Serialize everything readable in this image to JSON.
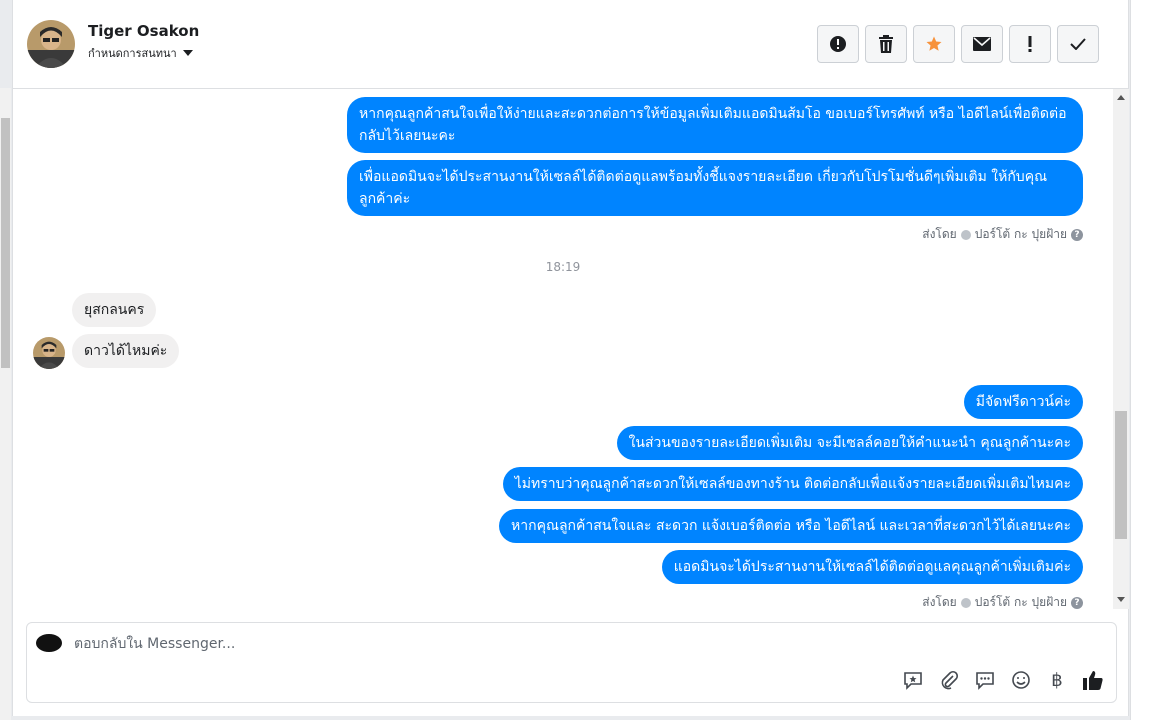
{
  "header": {
    "contact_name": "Tiger Osakon",
    "assign_label": "กำหนดการสนทนา"
  },
  "toolbar": {
    "buttons": [
      "alert-icon",
      "trash-icon",
      "star-icon",
      "mail-icon",
      "exclamation-icon",
      "check-icon"
    ],
    "star_color": "#f7923b"
  },
  "messages": {
    "out_1": "หากคุณลูกค้าสนใจเพื่อให้ง่ายและสะดวกต่อการให้ข้อมูลเพิ่มเติมแอดมินส้มโอ ขอเบอร์โทรศัพท์ หรือ ไอดีไลน์เพื่อติดต่อกลับไว้เลยนะคะ",
    "out_2": "เพื่อแอดมินจะได้ประสานงานให้เซลล์ได้ติดต่อดูแลพร้อมทั้งชี้แจงรายละเอียด เกี่ยวกับโปรโมชั่นดีๆเพิ่มเติม ให้กับคุณลูกค้าค่ะ",
    "sent_by_1": "ส่งโดย",
    "sender_1": "ปอร์โต้ กะ ปุยฝ้าย",
    "timestamp": "18:19",
    "in_1": "ยุสกลนคร",
    "in_2": "ดาวได้ไหมค่ะ",
    "out_3": "มีจัดฟรีดาวน์ค่ะ",
    "out_4": "ในส่วนของรายละเอียดเพิ่มเติม จะมีเซลล์คอยให้คำแนะนำ คุณลูกค้านะคะ",
    "out_5": "ไม่ทราบว่าคุณลูกค้าสะดวกให้เซลล์ของทางร้าน ติดต่อกลับเพื่อแจ้งรายละเอียดเพิ่มเติมไหมคะ",
    "out_6": "หากคุณลูกค้าสนใจและ สะดวก แจ้งเบอร์ติดต่อ หรือ ไอดีไลน์ และเวลาที่สะดวกไว้ได้เลยนะคะ",
    "out_7": "แอดมินจะได้ประสานงานให้เซลล์ได้ติดต่อดูแลคุณลูกค้าเพิ่มเติมค่ะ",
    "sent_by_2": "ส่งโดย",
    "sender_2": "ปอร์โต้ กะ ปุยฝ้าย"
  },
  "composer": {
    "placeholder": "ตอบกลับใน Messenger...",
    "baht_symbol": "฿",
    "tools": [
      "saved-reply-icon",
      "attachment-icon",
      "chat-bubble-icon",
      "emoji-icon",
      "baht-icon",
      "thumbs-up-icon"
    ]
  },
  "colors": {
    "outgoing_bubble": "#0084ff",
    "incoming_bubble": "#f1f0f0"
  }
}
